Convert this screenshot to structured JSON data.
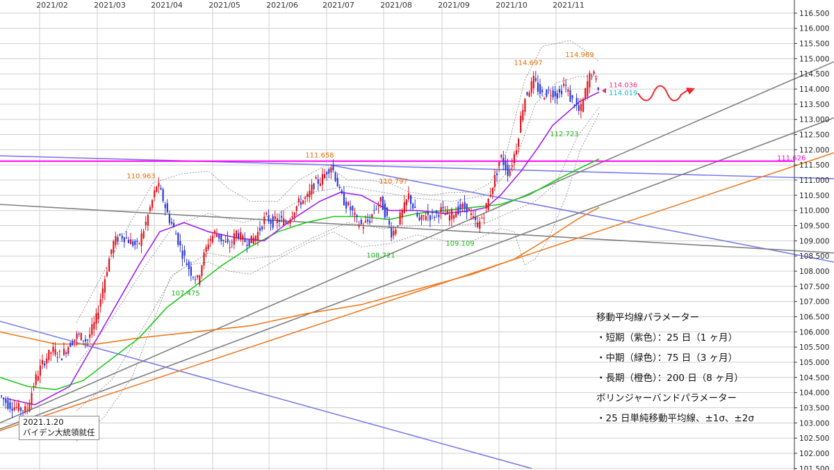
{
  "chart_data": {
    "type": "candlestick",
    "months": [
      "2021/02",
      "2021/03",
      "2021/04",
      "2021/05",
      "2021/06",
      "2021/07",
      "2021/08",
      "2021/09",
      "2021/10",
      "2021/11"
    ],
    "y_ticks": [
      "101.500",
      "102.000",
      "102.500",
      "103.000",
      "103.500",
      "104.000",
      "104.500",
      "105.000",
      "105.500",
      "106.000",
      "106.500",
      "107.000",
      "107.500",
      "108.000",
      "108.500",
      "109.000",
      "109.500",
      "110.000",
      "110.500",
      "111.000",
      "111.500",
      "112.000",
      "112.500",
      "113.000",
      "113.500",
      "114.000",
      "114.500",
      "115.000",
      "115.500",
      "116.000",
      "116.500"
    ],
    "ylim": [
      101.45,
      116.75
    ],
    "grid": true,
    "price_path": [
      [
        0,
        103.9
      ],
      [
        12,
        103.6
      ],
      [
        25,
        103.5
      ],
      [
        38,
        103.4
      ],
      [
        50,
        104.4
      ],
      [
        62,
        105.0
      ],
      [
        75,
        105.4
      ],
      [
        88,
        105.2
      ],
      [
        100,
        105.6
      ],
      [
        112,
        105.9
      ],
      [
        125,
        105.7
      ],
      [
        138,
        106.4
      ],
      [
        150,
        107.7
      ],
      [
        162,
        108.9
      ],
      [
        174,
        109.2
      ],
      [
        186,
        109.0
      ],
      [
        198,
        108.8
      ],
      [
        210,
        109.6
      ],
      [
        220,
        110.4
      ],
      [
        226,
        110.9
      ],
      [
        234,
        110.4
      ],
      [
        242,
        109.8
      ],
      [
        252,
        109.3
      ],
      [
        262,
        108.6
      ],
      [
        274,
        108.0
      ],
      [
        284,
        107.7
      ],
      [
        292,
        108.4
      ],
      [
        300,
        109.0
      ],
      [
        310,
        109.3
      ],
      [
        320,
        109.0
      ],
      [
        330,
        108.8
      ],
      [
        340,
        109.3
      ],
      [
        350,
        109.0
      ],
      [
        362,
        109.0
      ],
      [
        372,
        109.3
      ],
      [
        382,
        109.8
      ],
      [
        392,
        109.6
      ],
      [
        402,
        109.7
      ],
      [
        412,
        109.6
      ],
      [
        422,
        110.0
      ],
      [
        432,
        110.3
      ],
      [
        442,
        110.4
      ],
      [
        452,
        110.9
      ],
      [
        462,
        111.0
      ],
      [
        470,
        111.3
      ],
      [
        477,
        111.5
      ],
      [
        484,
        111.0
      ],
      [
        490,
        110.5
      ],
      [
        498,
        110.2
      ],
      [
        506,
        110.0
      ],
      [
        514,
        109.6
      ],
      [
        522,
        109.5
      ],
      [
        532,
        109.7
      ],
      [
        540,
        110.1
      ],
      [
        548,
        110.3
      ],
      [
        556,
        109.8
      ],
      [
        564,
        109.2
      ],
      [
        572,
        109.6
      ],
      [
        580,
        110.0
      ],
      [
        588,
        110.5
      ],
      [
        596,
        110.0
      ],
      [
        604,
        109.6
      ],
      [
        612,
        109.9
      ],
      [
        622,
        109.8
      ],
      [
        634,
        110.0
      ],
      [
        646,
        109.8
      ],
      [
        656,
        110.0
      ],
      [
        664,
        110.1
      ],
      [
        672,
        110.1
      ],
      [
        680,
        109.7
      ],
      [
        688,
        109.5
      ],
      [
        696,
        109.9
      ],
      [
        702,
        110.3
      ],
      [
        708,
        110.8
      ],
      [
        714,
        111.2
      ],
      [
        720,
        111.8
      ],
      [
        726,
        111.5
      ],
      [
        732,
        111.2
      ],
      [
        738,
        111.7
      ],
      [
        744,
        112.2
      ],
      [
        750,
        113.2
      ],
      [
        756,
        113.8
      ],
      [
        762,
        114.0
      ],
      [
        768,
        114.3
      ],
      [
        774,
        114.0
      ],
      [
        780,
        113.8
      ],
      [
        788,
        113.9
      ],
      [
        796,
        113.9
      ],
      [
        804,
        113.8
      ],
      [
        812,
        114.2
      ],
      [
        820,
        113.7
      ],
      [
        828,
        113.5
      ],
      [
        834,
        113.2
      ],
      [
        840,
        113.7
      ],
      [
        846,
        114.3
      ],
      [
        852,
        114.6
      ],
      [
        858,
        114.2
      ],
      [
        862,
        114.0
      ]
    ],
    "ma25": [
      [
        10,
        103.8
      ],
      [
        50,
        103.6
      ],
      [
        100,
        104.2
      ],
      [
        140,
        105.8
      ],
      [
        170,
        107.0
      ],
      [
        200,
        108.2
      ],
      [
        230,
        109.3
      ],
      [
        265,
        109.6
      ],
      [
        300,
        109.3
      ],
      [
        340,
        109.1
      ],
      [
        380,
        109.0
      ],
      [
        420,
        109.7
      ],
      [
        460,
        110.3
      ],
      [
        490,
        110.6
      ],
      [
        520,
        110.5
      ],
      [
        560,
        110.0
      ],
      [
        600,
        110.0
      ],
      [
        640,
        109.9
      ],
      [
        680,
        110.0
      ],
      [
        700,
        110.1
      ],
      [
        720,
        110.5
      ],
      [
        750,
        111.3
      ],
      [
        775,
        112.1
      ],
      [
        795,
        112.8
      ],
      [
        815,
        113.2
      ],
      [
        835,
        113.6
      ],
      [
        862,
        113.9
      ]
    ],
    "ma75": [
      [
        0,
        104.5
      ],
      [
        40,
        104.2
      ],
      [
        80,
        104.1
      ],
      [
        120,
        104.4
      ],
      [
        160,
        105.1
      ],
      [
        200,
        105.8
      ],
      [
        240,
        106.8
      ],
      [
        280,
        107.5
      ],
      [
        320,
        108.2
      ],
      [
        360,
        108.8
      ],
      [
        400,
        109.3
      ],
      [
        440,
        109.6
      ],
      [
        480,
        109.8
      ],
      [
        520,
        109.8
      ],
      [
        560,
        109.7
      ],
      [
        600,
        109.9
      ],
      [
        640,
        110.0
      ],
      [
        680,
        110.1
      ],
      [
        720,
        110.2
      ],
      [
        760,
        110.5
      ],
      [
        800,
        111.0
      ],
      [
        835,
        111.4
      ],
      [
        862,
        111.7
      ]
    ],
    "ma200": [
      [
        0,
        106.0
      ],
      [
        40,
        105.8
      ],
      [
        80,
        105.6
      ],
      [
        140,
        105.6
      ],
      [
        200,
        105.8
      ],
      [
        280,
        106.0
      ],
      [
        360,
        106.2
      ],
      [
        440,
        106.6
      ],
      [
        520,
        106.9
      ],
      [
        600,
        107.4
      ],
      [
        680,
        107.9
      ],
      [
        740,
        108.4
      ],
      [
        790,
        109.1
      ],
      [
        830,
        109.7
      ],
      [
        862,
        110.1
      ]
    ],
    "bb_upper": [
      [
        110,
        106.3
      ],
      [
        150,
        108.0
      ],
      [
        190,
        109.7
      ],
      [
        220,
        110.9
      ],
      [
        260,
        111.2
      ],
      [
        300,
        111.3
      ],
      [
        330,
        110.7
      ],
      [
        360,
        110.3
      ],
      [
        400,
        110.3
      ],
      [
        430,
        111.0
      ],
      [
        470,
        111.5
      ],
      [
        500,
        111.0
      ],
      [
        530,
        111.0
      ],
      [
        560,
        110.9
      ],
      [
        590,
        110.6
      ],
      [
        620,
        110.5
      ],
      [
        650,
        110.6
      ],
      [
        680,
        110.6
      ],
      [
        705,
        110.9
      ],
      [
        730,
        112.0
      ],
      [
        755,
        114.3
      ],
      [
        780,
        115.4
      ],
      [
        800,
        115.5
      ],
      [
        820,
        115.6
      ],
      [
        840,
        115.3
      ],
      [
        862,
        114.9
      ]
    ],
    "bb_lower": [
      [
        110,
        102.4
      ],
      [
        150,
        103.2
      ],
      [
        190,
        104.5
      ],
      [
        220,
        106.3
      ],
      [
        245,
        107.8
      ],
      [
        270,
        108.2
      ],
      [
        300,
        108.3
      ],
      [
        330,
        108.0
      ],
      [
        360,
        107.9
      ],
      [
        400,
        108.4
      ],
      [
        440,
        108.9
      ],
      [
        480,
        109.3
      ],
      [
        520,
        108.8
      ],
      [
        560,
        108.9
      ],
      [
        600,
        109.2
      ],
      [
        640,
        109.0
      ],
      [
        680,
        109.0
      ],
      [
        700,
        109.2
      ],
      [
        720,
        109.4
      ],
      [
        740,
        109.3
      ],
      [
        755,
        108.2
      ],
      [
        770,
        108.4
      ],
      [
        790,
        109.1
      ],
      [
        815,
        110.5
      ],
      [
        835,
        112.0
      ],
      [
        862,
        113.2
      ]
    ],
    "bb_upper1": [
      [
        110,
        104.9
      ],
      [
        160,
        106.4
      ],
      [
        210,
        108.2
      ],
      [
        250,
        109.5
      ],
      [
        300,
        109.9
      ],
      [
        350,
        109.6
      ],
      [
        400,
        109.9
      ],
      [
        450,
        110.6
      ],
      [
        500,
        110.8
      ],
      [
        550,
        110.6
      ],
      [
        600,
        110.4
      ],
      [
        650,
        110.3
      ],
      [
        700,
        110.5
      ],
      [
        740,
        111.5
      ],
      [
        770,
        113.5
      ],
      [
        800,
        114.2
      ],
      [
        830,
        114.4
      ],
      [
        862,
        114.4
      ]
    ],
    "bb_lower1": [
      [
        110,
        103.4
      ],
      [
        160,
        104.4
      ],
      [
        210,
        106.3
      ],
      [
        250,
        107.9
      ],
      [
        300,
        108.6
      ],
      [
        350,
        108.4
      ],
      [
        400,
        108.5
      ],
      [
        450,
        109.1
      ],
      [
        500,
        109.6
      ],
      [
        550,
        109.4
      ],
      [
        600,
        109.5
      ],
      [
        650,
        109.5
      ],
      [
        700,
        109.6
      ],
      [
        740,
        110.0
      ],
      [
        770,
        110.3
      ],
      [
        800,
        110.9
      ],
      [
        830,
        112.4
      ],
      [
        862,
        113.4
      ]
    ],
    "trendlines": [
      {
        "color": "#7b7bea",
        "points": [
          [
            0,
            111.8
          ],
          [
            1200,
            111.05
          ]
        ]
      },
      {
        "color": "#7b7bea",
        "points": [
          [
            0,
            106.35
          ],
          [
            765,
            101.5
          ]
        ]
      },
      {
        "color": "#7b7bea",
        "points": [
          [
            475,
            111.5
          ],
          [
            1200,
            108.3
          ]
        ]
      },
      {
        "color": "#808080",
        "points": [
          [
            0,
            110.2
          ],
          [
            1200,
            108.6
          ]
        ]
      },
      {
        "color": "#808080",
        "points": [
          [
            0,
            103.0
          ],
          [
            1200,
            114.9
          ]
        ]
      },
      {
        "color": "#808080",
        "points": [
          [
            0,
            102.8
          ],
          [
            1200,
            113.05
          ]
        ]
      },
      {
        "color": "#ee7b26",
        "points": [
          [
            0,
            102.75
          ],
          [
            1200,
            111.9
          ]
        ]
      }
    ],
    "hline": {
      "value": 111.626,
      "color": "#ff00ff"
    },
    "labels": [
      {
        "text": "110.963",
        "x": 203,
        "y": 110.963,
        "color": "#e76b00"
      },
      {
        "text": "107.475",
        "x": 267,
        "y": 107.475,
        "color": "#18b418"
      },
      {
        "text": "111.658",
        "x": 460,
        "y": 111.658,
        "color": "#e76b00"
      },
      {
        "text": "108.721",
        "x": 548,
        "y": 108.721,
        "color": "#18b418"
      },
      {
        "text": "110.797",
        "x": 566,
        "y": 110.797,
        "color": "#e76b00"
      },
      {
        "text": "109.109",
        "x": 662,
        "y": 109.109,
        "color": "#18b418"
      },
      {
        "text": "114.697",
        "x": 760,
        "y": 114.697,
        "color": "#e76b00"
      },
      {
        "text": "114.969",
        "x": 834,
        "y": 114.969,
        "color": "#e76b00"
      },
      {
        "text": "112.723",
        "x": 812,
        "y": 112.723,
        "color": "#18b418"
      }
    ],
    "price_tags": [
      {
        "text": "114.036",
        "value": 114.036,
        "color": "#e0307a"
      },
      {
        "text": "114.019",
        "value": 114.019,
        "color": "#14b4d6"
      },
      {
        "text": "111.626",
        "value": 111.626,
        "color": "#ff00ff"
      }
    ]
  },
  "params": {
    "title": "移動平均線パラメーター",
    "line1": "・短期（紫色）：25 日（1 ヶ月）",
    "line2": "・中期（緑色）：75 日（3 ヶ月）",
    "line3": "・長期（橙色）：200 日（8 ヶ月）",
    "title2": "ボリンジャーバンドパラメーター",
    "line4": "・25 日単純移動平均線、±1σ、±2σ"
  },
  "event": {
    "date": "2021.1.20",
    "text": "バイデン大統領就任"
  }
}
